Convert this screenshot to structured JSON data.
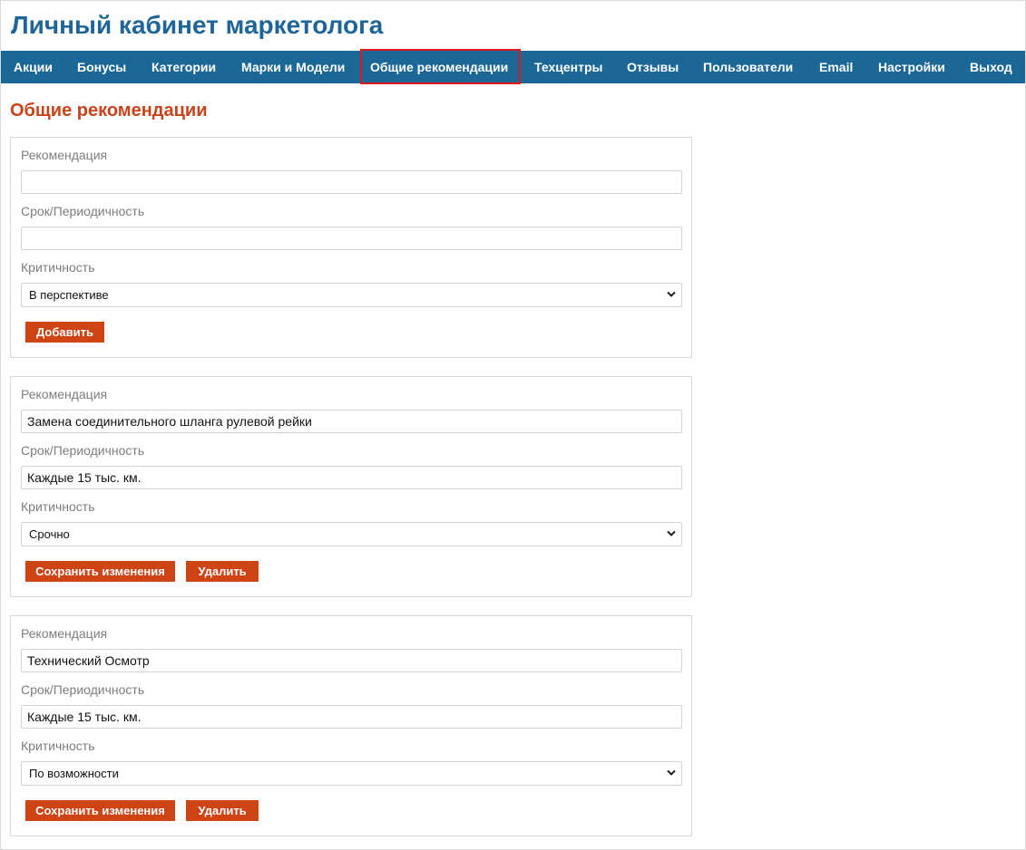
{
  "header": {
    "title": "Личный кабинет маркетолога"
  },
  "nav": {
    "items": [
      "Акции",
      "Бонусы",
      "Категории",
      "Марки и Модели",
      "Общие рекомендации",
      "Техцентры",
      "Отзывы",
      "Пользователи",
      "Email",
      "Настройки",
      "Выход"
    ],
    "active": "Общие рекомендации"
  },
  "page": {
    "title": "Общие рекомендации"
  },
  "labels": {
    "recommendation": "Рекомендация",
    "period": "Срок/Периодичность",
    "criticality": "Критичность"
  },
  "new_form": {
    "recommendation_value": "",
    "period_value": "",
    "criticality_value": "В перспективе",
    "add_button": "Добавить"
  },
  "records": [
    {
      "recommendation": "Замена соединительного шланга рулевой рейки",
      "period": "Каждые 15 тыс. км.",
      "criticality": "Срочно",
      "save_button": "Сохранить изменения",
      "delete_button": "Удалить"
    },
    {
      "recommendation": "Технический Осмотр",
      "period": "Каждые 15 тыс. км.",
      "criticality": "По возможности",
      "save_button": "Сохранить изменения",
      "delete_button": "Удалить"
    }
  ],
  "colors": {
    "brand_blue": "#1b6796",
    "title_blue": "#1f6598",
    "accent_orange": "#cf4414",
    "active_outline": "#e0161b"
  },
  "icons": {
    "select_arrow": "chevron-down-icon"
  }
}
